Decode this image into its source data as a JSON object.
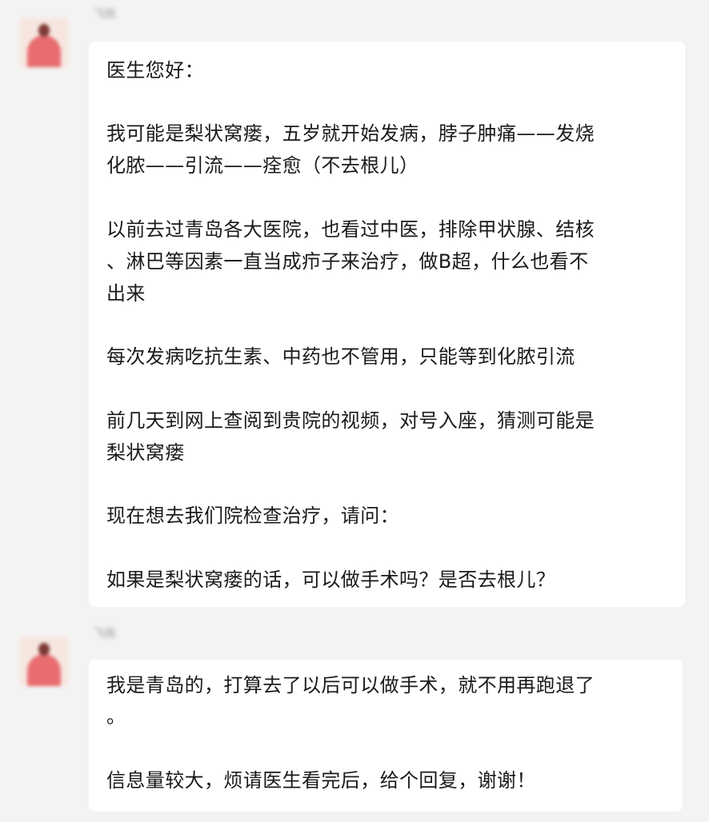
{
  "messages": [
    {
      "sender_name": "飞鸽",
      "lines": [
        "医生您好：",
        "我可能是梨状窝瘘，五岁就开始发病，脖子肿痛——发烧",
        "化脓——引流——痊愈（不去根儿）",
        "以前去过青岛各大医院，也看过中医，排除甲状腺、结核",
        "、淋巴等因素一直当成疖子来治疗，做B超，什么也看不",
        "出来",
        "每次发病吃抗生素、中药也不管用，只能等到化脓引流",
        "前几天到网上查阅到贵院的视频，对号入座，猜测可能是",
        "梨状窝瘘",
        "现在想去我们院检查治疗，请问：",
        "如果是梨状窝瘘的话，可以做手术吗？是否去根儿？"
      ]
    },
    {
      "sender_name": "飞鸽",
      "lines": [
        "我是青岛的，打算去了以后可以做手术，就不用再跑退了",
        "。",
        "信息量较大，烦请医生看完后，给个回复，谢谢！"
      ]
    }
  ]
}
